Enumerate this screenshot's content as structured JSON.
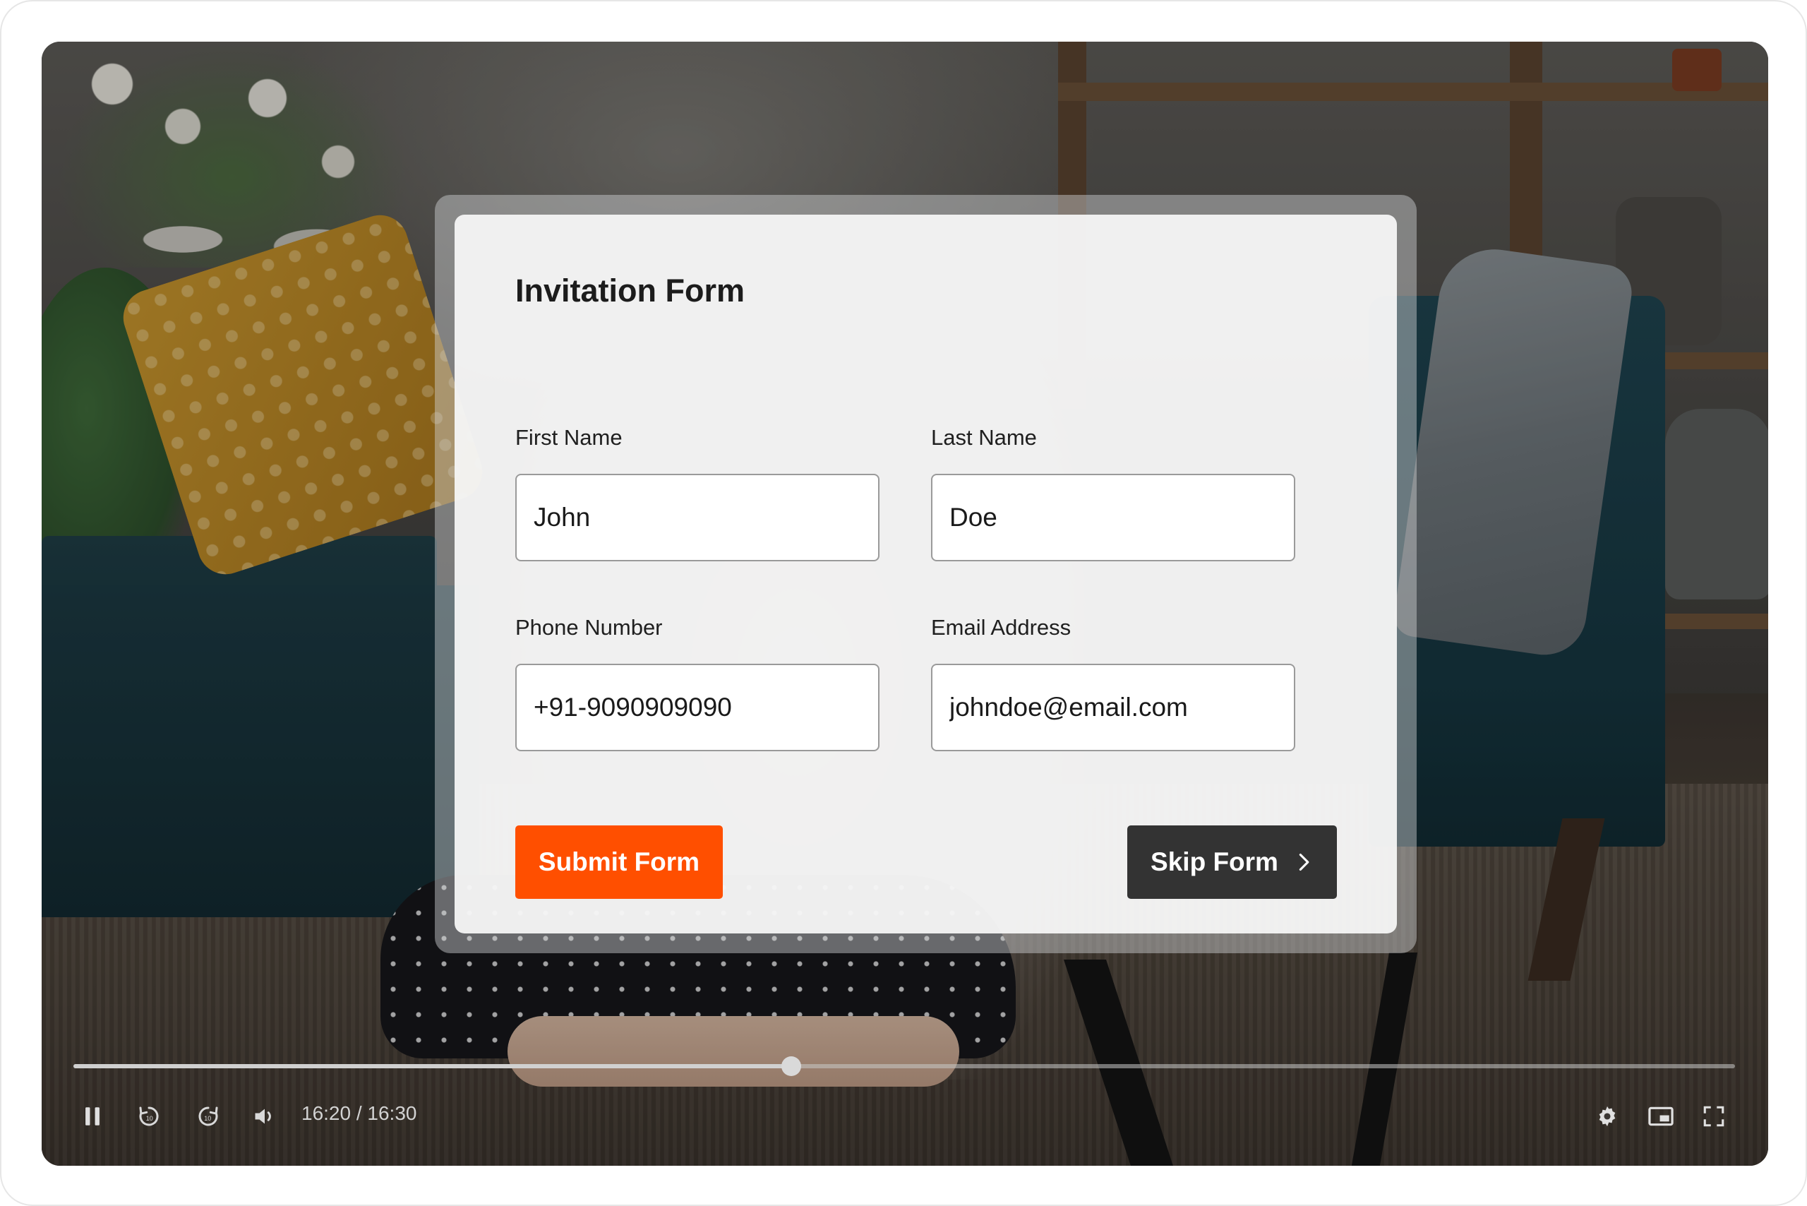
{
  "form": {
    "title": "Invitation Form",
    "first_name": {
      "label": "First Name",
      "value": "John"
    },
    "last_name": {
      "label": "Last Name",
      "value": "Doe"
    },
    "phone": {
      "label": "Phone Number",
      "value": "+91-9090909090"
    },
    "email": {
      "label": "Email Address",
      "value": "johndoe@email.com"
    },
    "submit_label": "Submit Form",
    "skip_label": "Skip Form"
  },
  "player": {
    "time_display": "16:20 / 16:30",
    "progress_fraction": 0.432,
    "icons": [
      "pause-icon",
      "rewind-10-icon",
      "forward-10-icon",
      "volume-icon",
      "settings-gear-icon",
      "miniplayer-icon",
      "fullscreen-icon"
    ]
  },
  "colors": {
    "submit": "#ff4f00",
    "skip": "#333333"
  }
}
